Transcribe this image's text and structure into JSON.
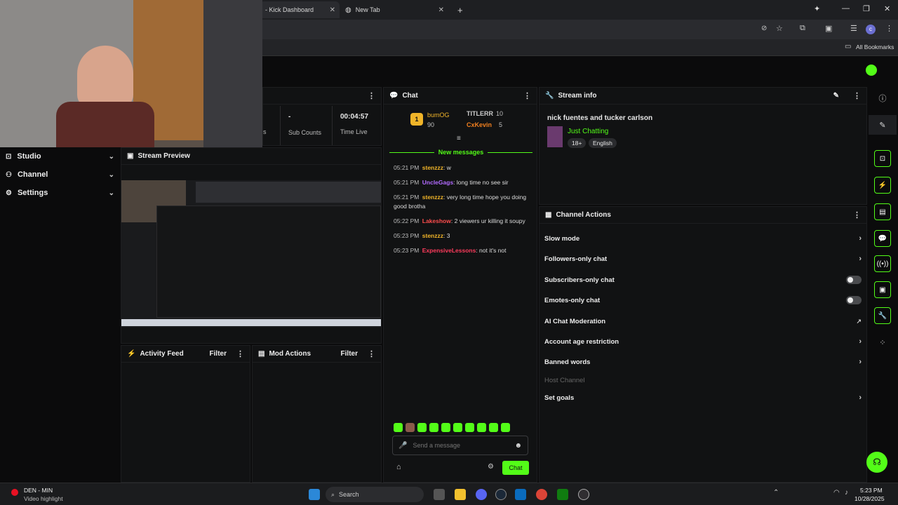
{
  "browser": {
    "tabs": [
      {
        "title": "- Kick Dashboard",
        "close": "✕"
      },
      {
        "title": "New Tab",
        "close": "✕"
      }
    ],
    "new_tab": "+",
    "bookmarks_label": "All Bookmarks"
  },
  "left_nav": {
    "items": [
      {
        "label": "Studio",
        "icon": "studio-icon"
      },
      {
        "label": "Channel",
        "icon": "channel-icon"
      },
      {
        "label": "Settings",
        "icon": "gear-icon"
      }
    ]
  },
  "stats_panel": {
    "partial_label": "s",
    "sub_value": "-",
    "sub_label": "Sub Counts",
    "time_value": "00:04:57",
    "time_label": "Time Live"
  },
  "stream_preview": {
    "title": "Stream Preview"
  },
  "activity_feed": {
    "title": "Activity Feed",
    "filter": "Filter"
  },
  "mod_actions": {
    "title": "Mod Actions",
    "filter": "Filter"
  },
  "chat": {
    "title": "Chat",
    "leaderboard": [
      {
        "rank": "1",
        "name": "bumOG",
        "count": "90"
      },
      {
        "name": "TITLERR",
        "count": "10"
      },
      {
        "name": "CxKevin",
        "count": "5"
      }
    ],
    "new_messages": "New messages",
    "messages": [
      {
        "time": "05:21 PM",
        "user": "stenzzz",
        "color": "#f0b429",
        "text": "w"
      },
      {
        "time": "05:21 PM",
        "user": "UncleGags",
        "color": "#b26bff",
        "text": "long time no see sir"
      },
      {
        "time": "05:21 PM",
        "user": "stenzzz",
        "color": "#f0b429",
        "text": "very long time hope you doing good brotha"
      },
      {
        "time": "05:22 PM",
        "user": "Lakeshow",
        "color": "#ff4d4d",
        "text": "2 viewers ur killing it soupy"
      },
      {
        "time": "05:23 PM",
        "user": "stenzzz",
        "color": "#f0b429",
        "text": "3"
      },
      {
        "time": "05:23 PM",
        "user": "ExpensiveLessons",
        "color": "#ff3b5c",
        "text": "not it's not"
      }
    ],
    "placeholder": "Send a message",
    "send": "Chat"
  },
  "stream_info": {
    "title": "Stream info",
    "stream_title": "nick fuentes and tucker carlson",
    "category": "Just Chatting",
    "tags": [
      "18+",
      "English"
    ]
  },
  "channel_actions": {
    "title": "Channel Actions",
    "items": [
      {
        "label": "Slow mode",
        "control": "chevron"
      },
      {
        "label": "Followers-only chat",
        "control": "chevron"
      },
      {
        "label": "Subscribers-only chat",
        "control": "toggle"
      },
      {
        "label": "Emotes-only chat",
        "control": "toggle"
      },
      {
        "label": "AI Chat Moderation",
        "control": "external"
      },
      {
        "label": "Account age restriction",
        "control": "chevron"
      },
      {
        "label": "Banned words",
        "control": "chevron"
      },
      {
        "label": "Host Channel",
        "control": "none"
      },
      {
        "label": "Set goals",
        "control": "chevron"
      }
    ]
  },
  "taskbar": {
    "notif_title": "DEN - MIN",
    "notif_sub": "Video highlight",
    "search": "Search",
    "time": "5:23 PM",
    "date": "10/28/2025"
  },
  "colors": {
    "accent": "#53fc18",
    "panel": "#111213"
  }
}
